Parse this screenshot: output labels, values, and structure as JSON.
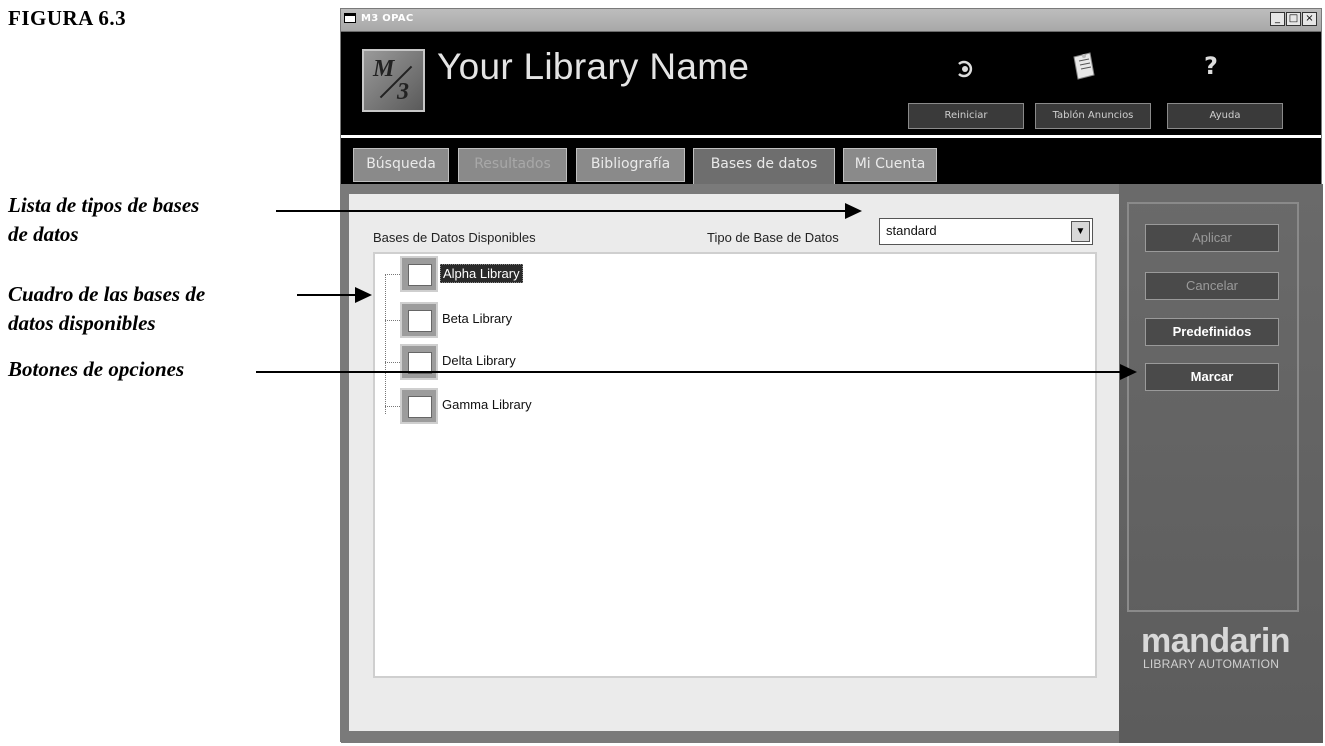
{
  "figure_label": "FIGURA 6.3",
  "annotations": [
    "Lista de tipos de bases",
    "de datos",
    "Cuadro de las bases de",
    "datos disponibles",
    "Botones de opciones"
  ],
  "window": {
    "title": "M3 OPAC",
    "controls": [
      "_",
      "□",
      "×"
    ]
  },
  "header": {
    "library_name": "Your Library Name",
    "icons": [
      "reset-icon",
      "bulletin-icon",
      "help-icon"
    ],
    "buttons": [
      "Reiniciar",
      "Tablón Anuncios",
      "Ayuda"
    ]
  },
  "tabs": [
    {
      "label": "Búsqueda",
      "state": "normal"
    },
    {
      "label": "Resultados",
      "state": "disabled"
    },
    {
      "label": "Bibliografía",
      "state": "normal"
    },
    {
      "label": "Bases de datos",
      "state": "active"
    },
    {
      "label": "Mi Cuenta",
      "state": "normal"
    }
  ],
  "databases": {
    "available_label": "Bases de Datos Disponibles",
    "type_label": "Tipo de Base de Datos",
    "type_value": "standard",
    "items": [
      {
        "label": "Alpha Library",
        "selected": true
      },
      {
        "label": "Beta Library",
        "selected": false
      },
      {
        "label": "Delta Library",
        "selected": false
      },
      {
        "label": "Gamma Library",
        "selected": false
      }
    ]
  },
  "options": {
    "buttons": [
      {
        "label": "Aplicar",
        "enabled": false
      },
      {
        "label": "Cancelar",
        "enabled": false
      },
      {
        "label": "Predefinidos",
        "enabled": true
      },
      {
        "label": "Marcar",
        "enabled": true
      }
    ]
  },
  "brand": {
    "name": "mandarin",
    "tagline": "LIBRARY AUTOMATION"
  }
}
